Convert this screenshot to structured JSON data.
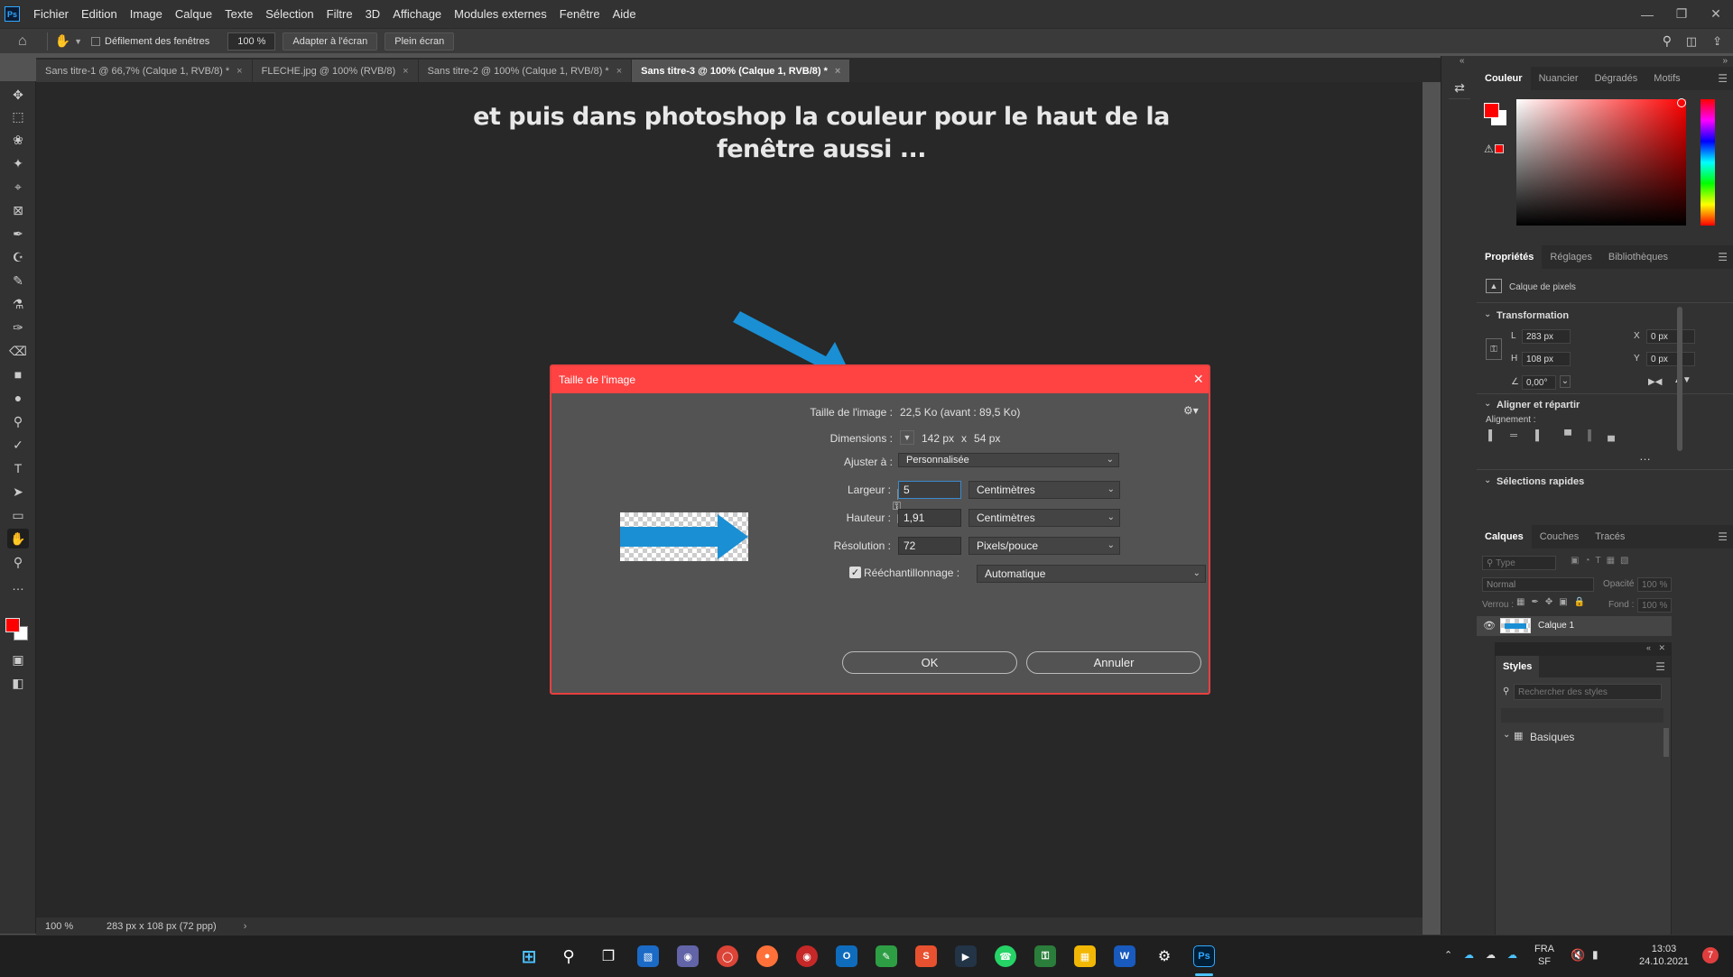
{
  "menubar": {
    "items": [
      "Fichier",
      "Edition",
      "Image",
      "Calque",
      "Texte",
      "Sélection",
      "Filtre",
      "3D",
      "Affichage",
      "Modules externes",
      "Fenêtre",
      "Aide"
    ],
    "logo": "Ps"
  },
  "options": {
    "scroll_all": "Défilement des fenêtres",
    "zoom": "100 %",
    "fit_screen": "Adapter à l'écran",
    "full_screen": "Plein écran"
  },
  "tabs": [
    {
      "label": "Sans titre-1 @ 66,7% (Calque 1, RVB/8) *"
    },
    {
      "label": "FLECHE.jpg @ 100% (RVB/8)"
    },
    {
      "label": "Sans titre-2 @ 100% (Calque 1, RVB/8) *"
    },
    {
      "label": "Sans titre-3 @ 100% (Calque 1, RVB/8) *"
    }
  ],
  "canvas": {
    "line1": "et puis dans photoshop la couleur pour le haut de la",
    "line2": "fenêtre aussi ..."
  },
  "status": {
    "zoom": "100 %",
    "doc_info": "283 px x 108 px (72 ppp)"
  },
  "dialog": {
    "title": "Taille de l'image",
    "size_label": "Taille de l'image :",
    "size_value": "22,5 Ko (avant : 89,5 Ko)",
    "dimensions_label": "Dimensions :",
    "dim_w": "142 px",
    "dim_x": "x",
    "dim_h": "54 px",
    "fit_label": "Ajuster à :",
    "fit_value": "Personnalisée",
    "width_label": "Largeur :",
    "width_value": "5",
    "width_unit": "Centimètres",
    "height_label": "Hauteur :",
    "height_value": "1,91",
    "height_unit": "Centimètres",
    "resolution_label": "Résolution :",
    "resolution_value": "72",
    "resolution_unit": "Pixels/pouce",
    "resample_label": "Rééchantillonnage :",
    "resample_value": "Automatique",
    "ok": "OK",
    "cancel": "Annuler"
  },
  "color_panel": {
    "tabs": [
      "Couleur",
      "Nuancier",
      "Dégradés",
      "Motifs"
    ],
    "foreground": "#ff0000",
    "background": "#ffffff"
  },
  "properties": {
    "tabs": [
      "Propriétés",
      "Réglages",
      "Bibliothèques"
    ],
    "layer_type": "Calque de pixels",
    "transform_title": "Transformation",
    "w_label": "L",
    "w_value": "283 px",
    "h_label": "H",
    "h_value": "108 px",
    "x_label": "X",
    "x_value": "0 px",
    "y_label": "Y",
    "y_value": "0 px",
    "angle": "0,00°",
    "align_title": "Aligner et répartir",
    "align_sub": "Alignement :",
    "quick_title": "Sélections rapides"
  },
  "layers": {
    "tabs": [
      "Calques",
      "Couches",
      "Tracés"
    ],
    "filter": "Type",
    "blend": "Normal",
    "opacity_label": "Opacité :",
    "opacity": "100 %",
    "lock_label": "Verrou :",
    "fill_label": "Fond :",
    "fill": "100 %",
    "layer_name": "Calque 1"
  },
  "styles": {
    "title": "Styles",
    "search_placeholder": "Rechercher des styles",
    "group": "Basiques"
  },
  "taskbar": {
    "lang1": "FRA",
    "lang2": "SF",
    "time": "13:03",
    "date": "24.10.2021",
    "badge": "7"
  }
}
